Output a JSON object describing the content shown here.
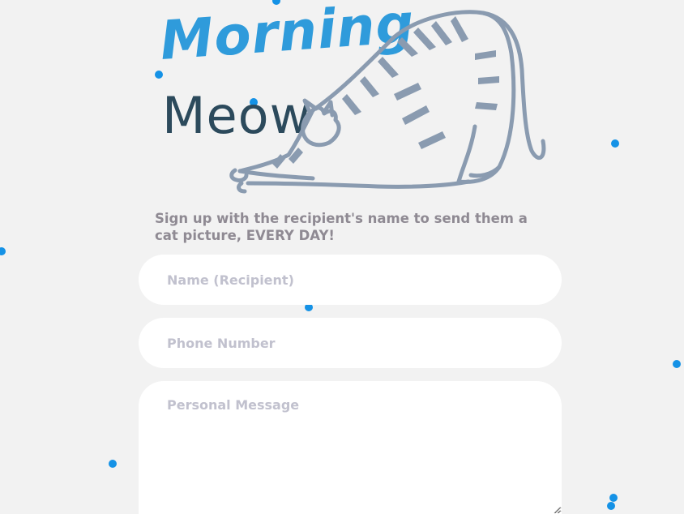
{
  "logo": {
    "line1": "Morning",
    "line2": "Meow",
    "cat_icon": "stretching-cat-icon",
    "colors": {
      "morning": "#2f9bdb",
      "meow": "#2c4a5c",
      "cat": "#8a9bb0"
    }
  },
  "tagline": "Sign up with the recipient's name to send them a cat picture, EVERY DAY!",
  "form": {
    "name_placeholder": "Name (Recipient)",
    "phone_placeholder": "Phone Number",
    "message_placeholder": "Personal Message"
  },
  "colors": {
    "background": "#f2f2f2",
    "dot": "#1592e6",
    "tagline": "#8f8a93",
    "placeholder": "#c1c1ce"
  }
}
